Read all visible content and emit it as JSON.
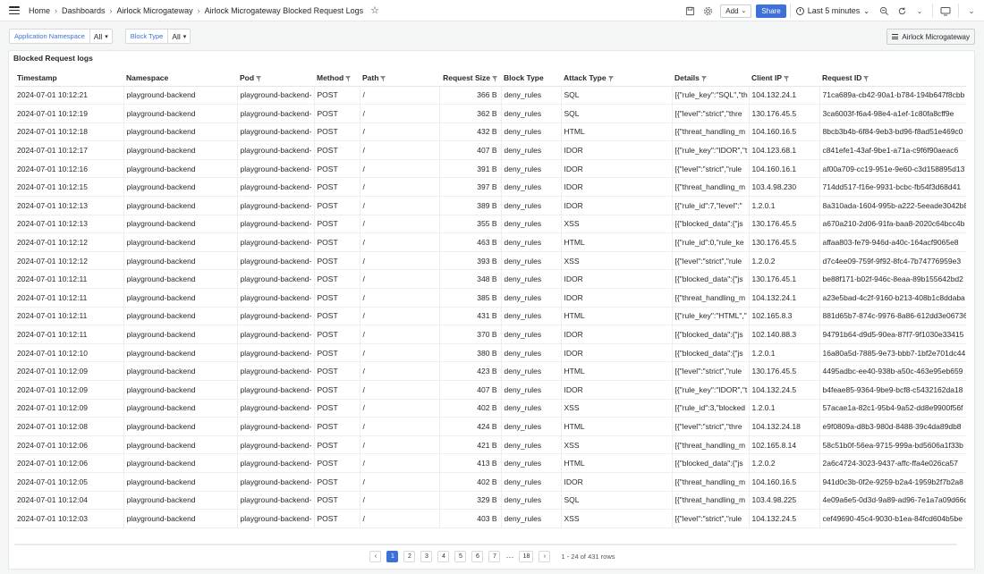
{
  "breadcrumb": {
    "items": [
      "Home",
      "Dashboards",
      "Airlock Microgateway",
      "Airlock Microgateway Blocked Request Logs"
    ]
  },
  "toolbar": {
    "add_label": "Add",
    "share_label": "Share",
    "time_range": "Last 5 minutes"
  },
  "filters": [
    {
      "label": "Application Namespace",
      "value": "All"
    },
    {
      "label": "Block Type",
      "value": "All"
    }
  ],
  "dashboard_link_label": "Airlock Microgateway",
  "panel": {
    "title": "Blocked Request logs",
    "columns": [
      {
        "label": "Timestamp",
        "filter": false
      },
      {
        "label": "Namespace",
        "filter": false
      },
      {
        "label": "Pod",
        "filter": true
      },
      {
        "label": "Method",
        "filter": true
      },
      {
        "label": "Path",
        "filter": true
      },
      {
        "label": "Request Size",
        "filter": true
      },
      {
        "label": "Block Type",
        "filter": false
      },
      {
        "label": "Attack Type",
        "filter": true
      },
      {
        "label": "Details",
        "filter": true
      },
      {
        "label": "Client IP",
        "filter": true
      },
      {
        "label": "Request ID",
        "filter": true
      }
    ],
    "rows": [
      [
        "2024-07-01 10:12:21",
        "playground-backend",
        "playground-backend-",
        "POST",
        "/",
        "366 B",
        "deny_rules",
        "SQL",
        "[{\"rule_key\":\"SQL\",\"th",
        "104.132.24.1",
        "71ca689a-cb42-90a1-b784-194b647f8cbb"
      ],
      [
        "2024-07-01 10:12:19",
        "playground-backend",
        "playground-backend-",
        "POST",
        "/",
        "362 B",
        "deny_rules",
        "SQL",
        "[{\"level\":\"strict\",\"thre",
        "130.176.45.5",
        "3ca6003f-f6a4-98e4-a1ef-1c80fa8cff9e"
      ],
      [
        "2024-07-01 10:12:18",
        "playground-backend",
        "playground-backend-",
        "POST",
        "/",
        "432 B",
        "deny_rules",
        "HTML",
        "[{\"threat_handling_m",
        "104.160.16.5",
        "8bcb3b4b-6f84-9eb3-bd96-f8ad51e469c0"
      ],
      [
        "2024-07-01 10:12:17",
        "playground-backend",
        "playground-backend-",
        "POST",
        "/",
        "407 B",
        "deny_rules",
        "IDOR",
        "[{\"rule_key\":\"IDOR\",\"t",
        "104.123.68.1",
        "c841efe1-43af-9be1-a71a-c9f6f90aeac6"
      ],
      [
        "2024-07-01 10:12:16",
        "playground-backend",
        "playground-backend-",
        "POST",
        "/",
        "391 B",
        "deny_rules",
        "IDOR",
        "[{\"level\":\"strict\",\"rule",
        "104.160.16.1",
        "af00a709-cc19-951e-9e60-c3d158895d13"
      ],
      [
        "2024-07-01 10:12:15",
        "playground-backend",
        "playground-backend-",
        "POST",
        "/",
        "397 B",
        "deny_rules",
        "IDOR",
        "[{\"threat_handling_m",
        "103.4.98.230",
        "714dd517-f16e-9931-bcbc-fb54f3d68d41"
      ],
      [
        "2024-07-01 10:12:13",
        "playground-backend",
        "playground-backend-",
        "POST",
        "/",
        "389 B",
        "deny_rules",
        "IDOR",
        "[{\"rule_id\":7,\"level\":\"",
        "1.2.0.1",
        "8a310ada-1604-995b-a222-5eeade3042b8"
      ],
      [
        "2024-07-01 10:12:13",
        "playground-backend",
        "playground-backend-",
        "POST",
        "/",
        "355 B",
        "deny_rules",
        "XSS",
        "[{\"blocked_data\":{\"js",
        "130.176.45.5",
        "a670a210-2d06-91fa-baa8-2020c64bcc4b"
      ],
      [
        "2024-07-01 10:12:12",
        "playground-backend",
        "playground-backend-",
        "POST",
        "/",
        "463 B",
        "deny_rules",
        "HTML",
        "[{\"rule_id\":0,\"rule_ke",
        "130.176.45.5",
        "affaa803-fe79-946d-a40c-164acf9065e8"
      ],
      [
        "2024-07-01 10:12:12",
        "playground-backend",
        "playground-backend-",
        "POST",
        "/",
        "393 B",
        "deny_rules",
        "XSS",
        "[{\"level\":\"strict\",\"rule",
        "1.2.0.2",
        "d7c4ee09-759f-9f92-8fc4-7b74776959e3"
      ],
      [
        "2024-07-01 10:12:11",
        "playground-backend",
        "playground-backend-",
        "POST",
        "/",
        "348 B",
        "deny_rules",
        "IDOR",
        "[{\"blocked_data\":{\"js",
        "130.176.45.1",
        "be88f171-b02f-946c-8eaa-89b155642bd2"
      ],
      [
        "2024-07-01 10:12:11",
        "playground-backend",
        "playground-backend-",
        "POST",
        "/",
        "385 B",
        "deny_rules",
        "IDOR",
        "[{\"threat_handling_m",
        "104.132.24.1",
        "a23e5bad-4c2f-9160-b213-408b1c8ddaba"
      ],
      [
        "2024-07-01 10:12:11",
        "playground-backend",
        "playground-backend-",
        "POST",
        "/",
        "431 B",
        "deny_rules",
        "HTML",
        "[{\"rule_key\":\"HTML\",\"",
        "102.165.8.3",
        "881d65b7-874c-9976-8a86-612dd3e06736"
      ],
      [
        "2024-07-01 10:12:11",
        "playground-backend",
        "playground-backend-",
        "POST",
        "/",
        "370 B",
        "deny_rules",
        "IDOR",
        "[{\"blocked_data\":{\"js",
        "102.140.88.3",
        "94791b64-d9d5-90ea-87f7-9f1030e33415"
      ],
      [
        "2024-07-01 10:12:10",
        "playground-backend",
        "playground-backend-",
        "POST",
        "/",
        "380 B",
        "deny_rules",
        "IDOR",
        "[{\"blocked_data\":{\"js",
        "1.2.0.1",
        "16a80a5d-7885-9e73-bbb7-1bf2e701dc44"
      ],
      [
        "2024-07-01 10:12:09",
        "playground-backend",
        "playground-backend-",
        "POST",
        "/",
        "423 B",
        "deny_rules",
        "HTML",
        "[{\"level\":\"strict\",\"rule",
        "130.176.45.5",
        "4495adbc-ee40-938b-a50c-463e95eb659"
      ],
      [
        "2024-07-01 10:12:09",
        "playground-backend",
        "playground-backend-",
        "POST",
        "/",
        "407 B",
        "deny_rules",
        "IDOR",
        "[{\"rule_key\":\"IDOR\",\"t",
        "104.132.24.5",
        "b4feae85-9364-9be9-bcf8-c5432162da18"
      ],
      [
        "2024-07-01 10:12:09",
        "playground-backend",
        "playground-backend-",
        "POST",
        "/",
        "402 B",
        "deny_rules",
        "XSS",
        "[{\"rule_id\":3,\"blocked",
        "1.2.0.1",
        "57acae1a-82c1-95b4-9a52-dd8e9900f56f"
      ],
      [
        "2024-07-01 10:12:08",
        "playground-backend",
        "playground-backend-",
        "POST",
        "/",
        "424 B",
        "deny_rules",
        "HTML",
        "[{\"level\":\"strict\",\"thre",
        "104.132.24.18",
        "e9f0809a-d8b3-980d-8488-39c4da89db8"
      ],
      [
        "2024-07-01 10:12:06",
        "playground-backend",
        "playground-backend-",
        "POST",
        "/",
        "421 B",
        "deny_rules",
        "XSS",
        "[{\"threat_handling_m",
        "102.165.8.14",
        "58c51b0f-56ea-9715-999a-bd5606a1f33b"
      ],
      [
        "2024-07-01 10:12:06",
        "playground-backend",
        "playground-backend-",
        "POST",
        "/",
        "413 B",
        "deny_rules",
        "HTML",
        "[{\"blocked_data\":{\"js",
        "1.2.0.2",
        "2a6c4724-3023-9437-affc-ffa4e026ca57"
      ],
      [
        "2024-07-01 10:12:05",
        "playground-backend",
        "playground-backend-",
        "POST",
        "/",
        "402 B",
        "deny_rules",
        "IDOR",
        "[{\"threat_handling_m",
        "104.160.16.5",
        "941d0c3b-0f2e-9259-b2a4-1959b2f7b2a8"
      ],
      [
        "2024-07-01 10:12:04",
        "playground-backend",
        "playground-backend-",
        "POST",
        "/",
        "329 B",
        "deny_rules",
        "SQL",
        "[{\"threat_handling_m",
        "103.4.98.225",
        "4e09a6e5-0d3d-9a89-ad96-7e1a7a09d66d"
      ],
      [
        "2024-07-01 10:12:03",
        "playground-backend",
        "playground-backend-",
        "POST",
        "/",
        "403 B",
        "deny_rules",
        "XSS",
        "[{\"level\":\"strict\",\"rule",
        "104.132.24.5",
        "cef49690-45c4-9030-b1ea-84fcd604b5be"
      ]
    ]
  },
  "pagination": {
    "prev": "‹",
    "next": "›",
    "pages": [
      "1",
      "2",
      "3",
      "4",
      "5",
      "6",
      "7"
    ],
    "ellipsis": "···",
    "last": "18",
    "active": "1",
    "rows_info": "1 - 24 of 431 rows"
  },
  "colors": {
    "accent": "#3d71d9",
    "border": "#e4e6ea",
    "background": "#f4f5f5"
  }
}
